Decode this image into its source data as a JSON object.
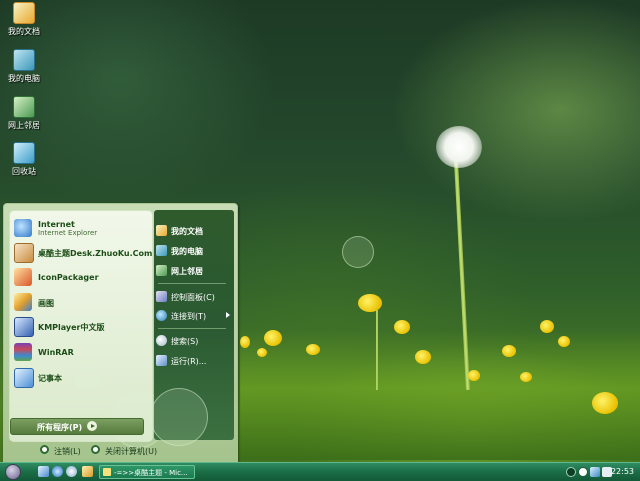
{
  "desktop_icons": [
    {
      "label": "我的文档",
      "icon": "documents-icon"
    },
    {
      "label": "我的电脑",
      "icon": "computer-icon"
    },
    {
      "label": "网上邻居",
      "icon": "network-icon"
    },
    {
      "label": "回收站",
      "icon": "recycle-bin-icon"
    }
  ],
  "start_menu": {
    "left_items": [
      {
        "title": "Internet",
        "subtitle": "Internet Explorer",
        "icon": "internet-explorer-icon"
      },
      {
        "title": "桌酷主题Desk.ZhuoKu.Com",
        "icon": "zhuoku-icon"
      },
      {
        "title": "IconPackager",
        "icon": "iconpackager-icon"
      },
      {
        "title": "画图",
        "icon": "paint-icon"
      },
      {
        "title": "KMPlayer中文版",
        "icon": "kmplayer-icon"
      },
      {
        "title": "WinRAR",
        "icon": "winrar-icon"
      },
      {
        "title": "记事本",
        "icon": "notepad-icon"
      }
    ],
    "all_programs_label": "所有程序(P)",
    "right_items": [
      {
        "label": "我的文档",
        "icon": "documents-icon"
      },
      {
        "label": "我的电脑",
        "icon": "computer-icon"
      },
      {
        "label": "网上邻居",
        "icon": "network-icon"
      },
      {
        "label": "控制面板(C)",
        "icon": "control-panel-icon"
      },
      {
        "label": "连接到(T)",
        "icon": "connect-to-icon"
      },
      {
        "label": "搜索(S)",
        "icon": "search-icon"
      },
      {
        "label": "运行(R)...",
        "icon": "run-icon"
      }
    ],
    "logoff_label": "注销(L)",
    "shutdown_label": "关闭计算机(U)"
  },
  "taskbar": {
    "task_label": "-=>>桌酷主题 - Mic...",
    "clock": "22:53"
  },
  "colors": {
    "taskbar": "#1a6d46",
    "start_menu_right": "#2e5a2c",
    "accent_text": "#1c4d17"
  }
}
